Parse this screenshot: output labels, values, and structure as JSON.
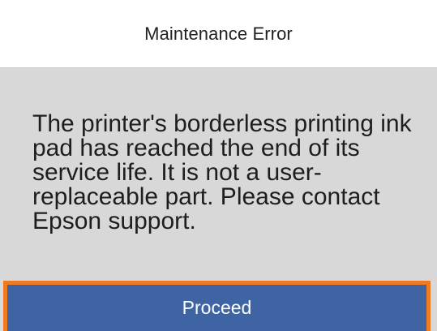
{
  "dialog": {
    "title": "Maintenance Error",
    "message": "The printer's borderless printing ink pad has reached the end of its service life. It is not a user-replaceable part. Please contact Epson support.",
    "button_label": "Proceed"
  },
  "colors": {
    "header_bg": "#ffffff",
    "panel_bg": "#d8d8d8",
    "button_bg": "#3f64a4",
    "focus_outline": "#f07a22",
    "text": "#1e1e1e"
  }
}
